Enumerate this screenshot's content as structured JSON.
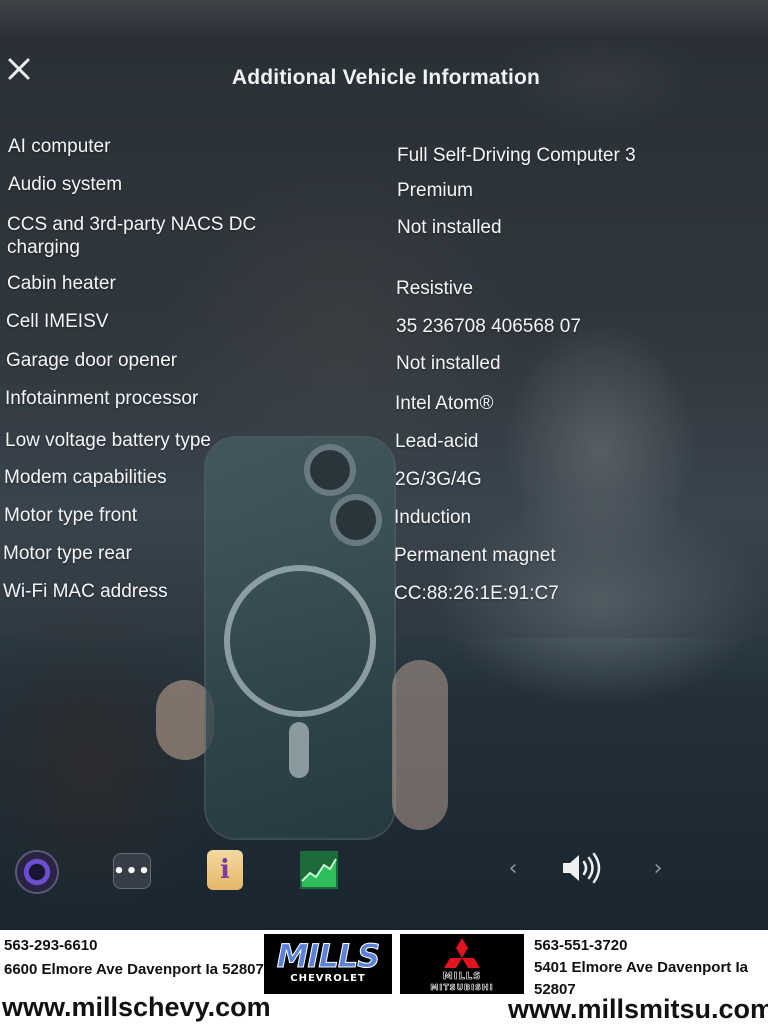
{
  "header": {
    "close_icon": "close-icon",
    "title": "Additional Vehicle Information"
  },
  "vehicle_info": [
    {
      "label": "AI computer",
      "value": "Full Self-Driving Computer 3"
    },
    {
      "label": "Audio system",
      "value": "Premium"
    },
    {
      "label": "CCS and 3rd-party NACS DC\ncharging",
      "value": "Not installed"
    },
    {
      "label": "Cabin heater",
      "value": "Resistive"
    },
    {
      "label": "Cell IMEISV",
      "value": "35 236708 406568 07"
    },
    {
      "label": "Garage door opener",
      "value": "Not installed"
    },
    {
      "label": "Infotainment processor",
      "value": "Intel Atom®"
    },
    {
      "label": "Low voltage battery type",
      "value": "Lead-acid"
    },
    {
      "label": "Modem capabilities",
      "value": "2G/3G/4G"
    },
    {
      "label": "Motor type front",
      "value": "Induction"
    },
    {
      "label": "Motor type rear",
      "value": "Permanent magnet"
    },
    {
      "label": "Wi-Fi MAC address",
      "value": "CC:88:26:1E:91:C7"
    }
  ],
  "dock": {
    "icons": [
      "camera-icon",
      "more-icon",
      "manual-icon",
      "chart-icon",
      "chevron-left-icon",
      "volume-icon",
      "chevron-right-icon"
    ],
    "more_glyph": "•••",
    "manual_glyph": "i",
    "arrow_left_glyph": "‹",
    "arrow_right_glyph": "›"
  },
  "footer": {
    "left_dealer": {
      "phone": "563-293-6610",
      "address": "6600 Elmore Ave Davenport Ia 52807",
      "url": "www.millschevy.com",
      "logo_word": "MILLS",
      "logo_sub": "CHEVROLET"
    },
    "right_dealer": {
      "phone": "563-551-3720",
      "address_line1": "5401 Elmore Ave Davenport Ia",
      "address_line2": "52807",
      "url": "www.millsmitsu.com",
      "logo_word": "MILLS",
      "logo_sub": "MITSUBISHI"
    }
  },
  "colors": {
    "panel_text": "#f4f4f4",
    "chevy_blue": "#5a82d8",
    "mitsubishi_red": "#e0141e",
    "footer_bg": "#ffffff"
  }
}
